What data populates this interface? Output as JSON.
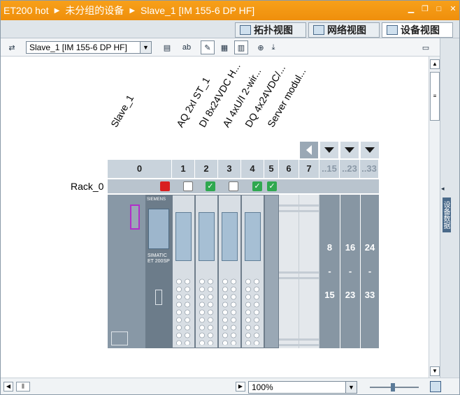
{
  "titlebar": {
    "crumbs": [
      "ET200 hot",
      "未分组的设备",
      "Slave_1 [IM 155-6 DP HF]"
    ]
  },
  "view_tabs": [
    {
      "label": "拓扑视图",
      "active": false
    },
    {
      "label": "网络视图",
      "active": false
    },
    {
      "label": "设备视图",
      "active": true
    }
  ],
  "toolbar": {
    "device_select": "Slave_1 [IM 155-6 DP HF]"
  },
  "canvas": {
    "device_label": "Slave_1",
    "module_labels": [
      "AQ 2xI ST_1",
      "DI 8x24VDC H...",
      "AI 4xU/I 2-wir...",
      "DQ 4x24VDC/...",
      "Server modul..."
    ],
    "rack_label": "Rack_0",
    "slot_numbers": [
      "0",
      "1",
      "2",
      "3",
      "4",
      "5",
      "6",
      "7"
    ],
    "slot_groups": [
      "..15",
      "..23",
      "..33"
    ],
    "group_ranges": [
      {
        "start": "8",
        "dash": "-",
        "end": "15"
      },
      {
        "start": "16",
        "dash": "-",
        "end": "23"
      },
      {
        "start": "24",
        "dash": "-",
        "end": "33"
      }
    ],
    "module_brand": "SIEMENS",
    "module_text": "SIMATIC",
    "head_text": "ET 200SP"
  },
  "side_panel": {
    "tab": "设备数据"
  },
  "bottombar": {
    "zoom": "100%"
  }
}
